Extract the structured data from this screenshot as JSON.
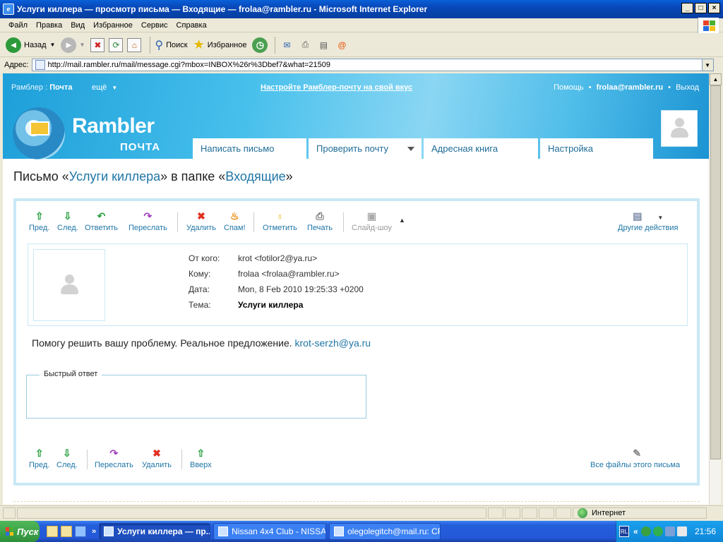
{
  "window": {
    "title": "Услуги киллера — просмотр письма — Входящие — frolaa@rambler.ru - Microsoft Internet Explorer"
  },
  "menu": [
    "Файл",
    "Правка",
    "Вид",
    "Избранное",
    "Сервис",
    "Справка"
  ],
  "toolbar": {
    "back": "Назад",
    "search": "Поиск",
    "favorites": "Избранное"
  },
  "address": {
    "label": "Адрес:",
    "url": "http://mail.rambler.ru/mail/message.cgi?mbox=INBOX%26r%3Dbef7&what=21509"
  },
  "rambler": {
    "nav_prefix": "Рамблер",
    "nav_sep": ":",
    "nav_current": "Почта",
    "more": "ещё",
    "promo": "Настройте Рамблер-почту на свой вкус",
    "help": "Помощь",
    "user": "frolaa@rambler.ru",
    "logout": "Выход",
    "logo_word": "Rambler",
    "logo_sub": "ПОЧТА",
    "tabs": [
      "Написать письмо",
      "Проверить почту",
      "Адресная книга",
      "Настройка"
    ]
  },
  "page": {
    "title_prefix": "Письмо «",
    "subject_link": "Услуги киллера",
    "title_mid": "» в папке «",
    "folder_link": "Входящие",
    "title_suffix": "»"
  },
  "actions": {
    "prev": "Пред.",
    "next": "След.",
    "reply": "Ответить",
    "forward": "Переслать",
    "delete": "Удалить",
    "spam": "Спам!",
    "mark": "Отметить",
    "print": "Печать",
    "slideshow": "Слайд-шоу",
    "other": "Другие действия"
  },
  "message": {
    "from_label": "От кого:",
    "from": "krot <fotilor2@ya.ru>",
    "to_label": "Кому:",
    "to": "frolaa <frolaa@rambler.ru>",
    "date_label": "Дата:",
    "date": "Mon, 8 Feb 2010 19:25:33 +0200",
    "subject_label": "Тема:",
    "subject": "Услуги киллера",
    "body": "Помогу решить вашу проблему. Реальное предложение.",
    "body_link": "krot-serzh@ya.ru"
  },
  "quick_reply": {
    "legend": "Быстрый ответ"
  },
  "bottom_actions": {
    "prev": "Пред.",
    "next": "След.",
    "forward": "Переслать",
    "delete": "Удалить",
    "up": "Вверх",
    "all_files": "Все файлы этого письма"
  },
  "status": {
    "zone": "Интернет"
  },
  "taskbar": {
    "start": "Пуск",
    "tasks": [
      "Услуги киллера — пр...",
      "Nissan 4x4 Club - NISSA...",
      "olegolegitch@mail.ru: CF..."
    ],
    "tray_lang": "RL",
    "clock": "21:56"
  }
}
